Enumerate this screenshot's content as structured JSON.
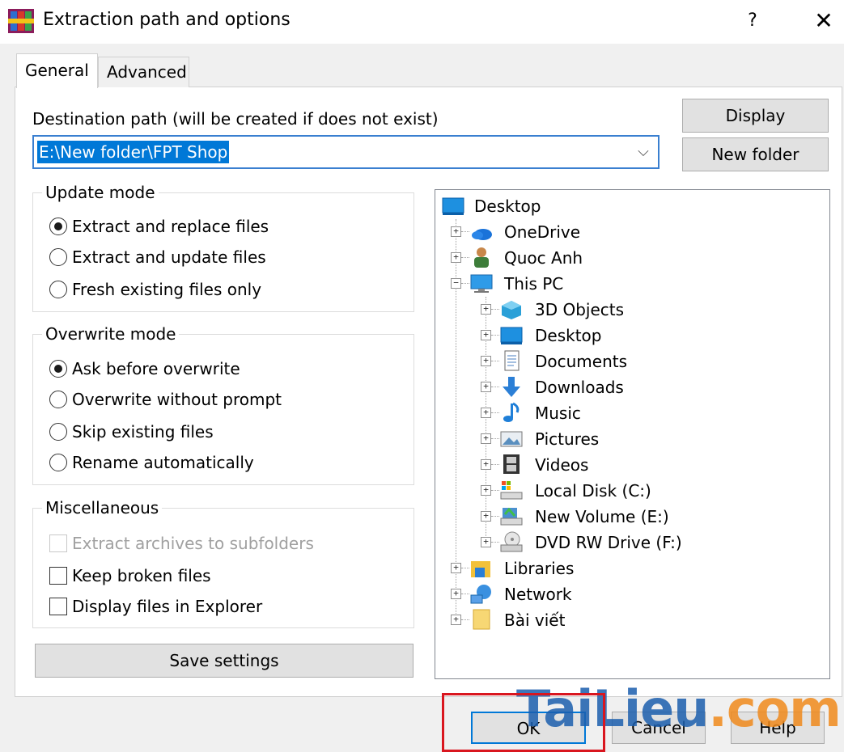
{
  "window": {
    "title": "Extraction path and options",
    "help_label": "?",
    "close_label": "✕"
  },
  "tabs": [
    {
      "label": "General",
      "active": true
    },
    {
      "label": "Advanced",
      "active": false
    }
  ],
  "destination": {
    "label": "Destination path (will be created if does not exist)",
    "value": "E:\\New folder\\FPT Shop",
    "arrow": "⌵"
  },
  "buttons": {
    "display": "Display",
    "new_folder": "New folder",
    "save_settings": "Save settings",
    "ok": "OK",
    "cancel": "Cancel",
    "help": "Help"
  },
  "update_mode": {
    "title": "Update mode",
    "options": [
      {
        "label": "Extract and replace files",
        "checked": true
      },
      {
        "label": "Extract and update files",
        "checked": false
      },
      {
        "label": "Fresh existing files only",
        "checked": false
      }
    ]
  },
  "overwrite_mode": {
    "title": "Overwrite mode",
    "options": [
      {
        "label": "Ask before overwrite",
        "checked": true
      },
      {
        "label": "Overwrite without prompt",
        "checked": false
      },
      {
        "label": "Skip existing files",
        "checked": false
      },
      {
        "label": "Rename automatically",
        "checked": false
      }
    ]
  },
  "miscellaneous": {
    "title": "Miscellaneous",
    "options": [
      {
        "label": "Extract archives to subfolders",
        "checked": false,
        "disabled": true
      },
      {
        "label": "Keep broken files",
        "checked": false,
        "disabled": false
      },
      {
        "label": "Display files in Explorer",
        "checked": false,
        "disabled": false
      }
    ]
  },
  "tree": {
    "items": [
      {
        "label": "Desktop",
        "icon": "desktop-icon",
        "expander": ""
      },
      {
        "label": "OneDrive",
        "icon": "cloud-icon",
        "expander": "+"
      },
      {
        "label": "Quoc Anh",
        "icon": "user-icon",
        "expander": "+"
      },
      {
        "label": "This PC",
        "icon": "computer-icon",
        "expander": "−"
      },
      {
        "label": "3D Objects",
        "icon": "cube-icon",
        "expander": "+"
      },
      {
        "label": "Desktop",
        "icon": "desktop-icon",
        "expander": "+"
      },
      {
        "label": "Documents",
        "icon": "document-icon",
        "expander": "+"
      },
      {
        "label": "Downloads",
        "icon": "download-icon",
        "expander": "+"
      },
      {
        "label": "Music",
        "icon": "music-icon",
        "expander": "+"
      },
      {
        "label": "Pictures",
        "icon": "pictures-icon",
        "expander": "+"
      },
      {
        "label": "Videos",
        "icon": "film-icon",
        "expander": "+"
      },
      {
        "label": "Local Disk (C:)",
        "icon": "drive-icon",
        "expander": "+"
      },
      {
        "label": "New Volume (E:)",
        "icon": "drive-icon",
        "expander": "+"
      },
      {
        "label": "DVD RW Drive (F:)",
        "icon": "dvd-icon",
        "expander": "+"
      },
      {
        "label": "Libraries",
        "icon": "library-icon",
        "expander": "+"
      },
      {
        "label": "Network",
        "icon": "network-icon",
        "expander": "+"
      },
      {
        "label": "Bài viết",
        "icon": "folder-icon",
        "expander": "+"
      }
    ]
  },
  "watermark": {
    "main": "TaiLieu",
    "tld": ".com"
  },
  "colors": {
    "accent": "#0078d7",
    "highlight_box": "#d9161f",
    "watermark_blue": "#1c5fae",
    "watermark_orange": "#f08a1c"
  }
}
